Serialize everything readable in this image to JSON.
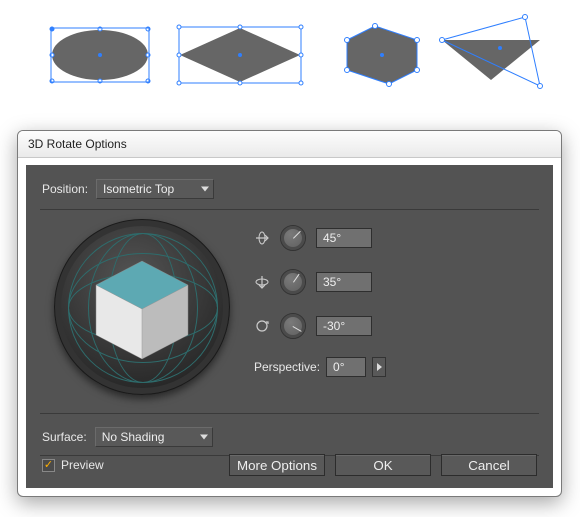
{
  "canvas": {
    "shapes": [
      "ellipse",
      "rhombus",
      "hexagon",
      "triangle"
    ]
  },
  "dialog": {
    "title": "3D Rotate Options",
    "position": {
      "label": "Position:",
      "value": "Isometric Top"
    },
    "axes": {
      "x": "45°",
      "y": "35°",
      "z": "-30°"
    },
    "perspective": {
      "label": "Perspective:",
      "value": "0°"
    },
    "surface": {
      "label": "Surface:",
      "value": "No Shading"
    },
    "preview": {
      "label": "Preview",
      "checked": true
    },
    "buttons": {
      "more": "More Options",
      "ok": "OK",
      "cancel": "Cancel"
    }
  }
}
